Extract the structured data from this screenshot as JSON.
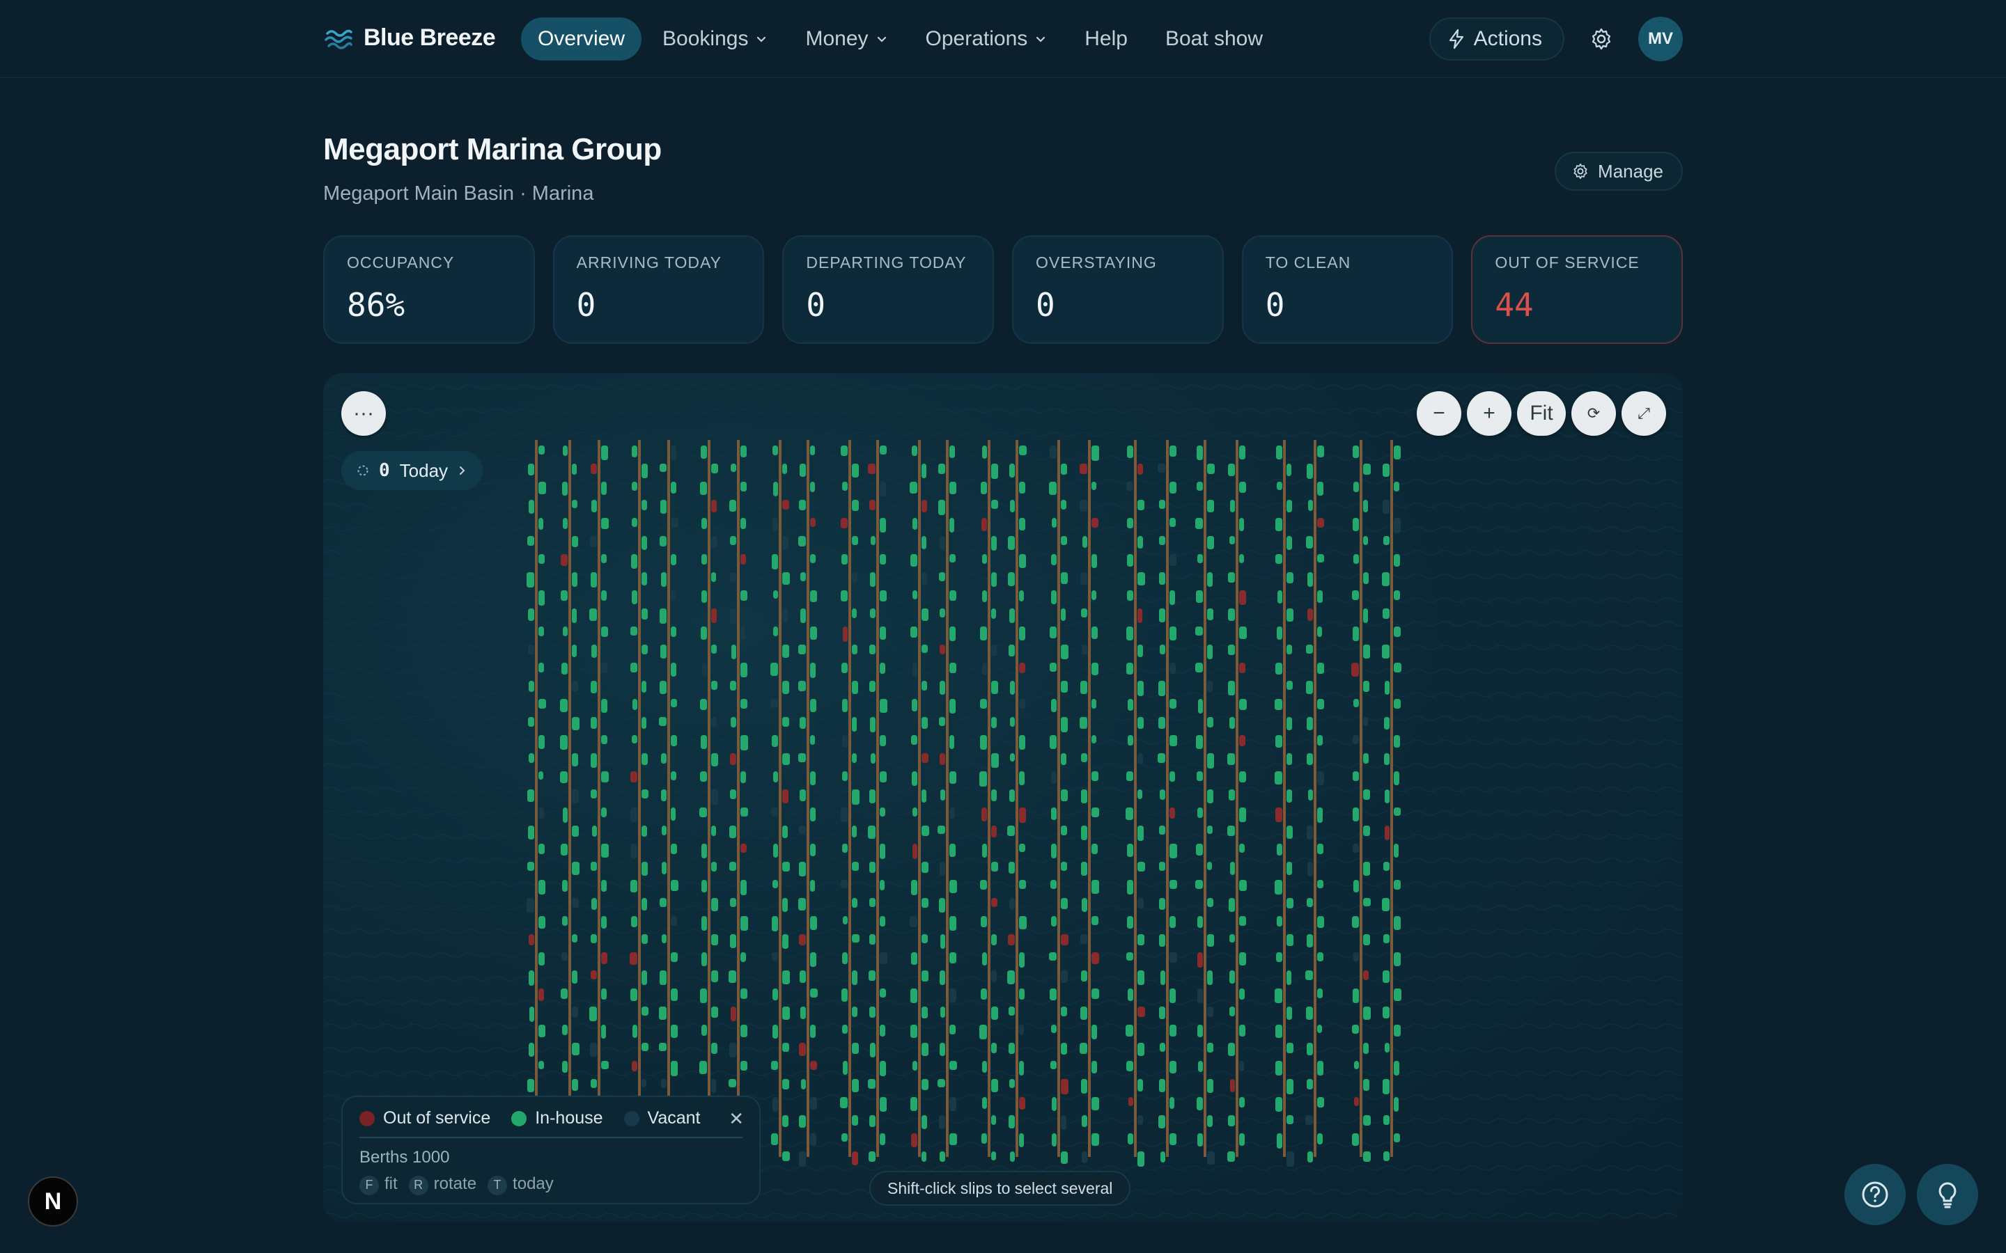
{
  "app": {
    "name": "Blue Breeze",
    "logo_icon": "waves-logo-icon"
  },
  "nav": {
    "items": [
      {
        "label": "Overview",
        "active": true,
        "dropdown": false
      },
      {
        "label": "Bookings",
        "active": false,
        "dropdown": true
      },
      {
        "label": "Money",
        "active": false,
        "dropdown": true
      },
      {
        "label": "Operations",
        "active": false,
        "dropdown": true
      },
      {
        "label": "Help",
        "active": false,
        "dropdown": false
      },
      {
        "label": "Boat show",
        "active": false,
        "dropdown": false
      }
    ],
    "actions_label": "Actions",
    "avatar_initials": "MV"
  },
  "header": {
    "title": "Megaport Marina Group",
    "subtitle": "Megaport Main Basin · Marina",
    "manage_label": "Manage"
  },
  "kpis": [
    {
      "label": "OCCUPANCY",
      "value": "86%"
    },
    {
      "label": "ARRIVING TODAY",
      "value": "0"
    },
    {
      "label": "DEPARTING TODAY",
      "value": "0"
    },
    {
      "label": "OVERSTAYING",
      "value": "0"
    },
    {
      "label": "TO CLEAN",
      "value": "0"
    },
    {
      "label": "OUT OF SERVICE",
      "value": "44"
    }
  ],
  "map": {
    "more_label": "···",
    "zoom_out_label": "−",
    "zoom_in_label": "+",
    "fit_label": "Fit",
    "rotate_label": "⟳",
    "expand_label": "⤢",
    "today": {
      "count": "0",
      "label": "Today"
    },
    "legend": {
      "items": [
        {
          "label": "Out of service",
          "color": "#7a2326"
        },
        {
          "label": "In-house",
          "color": "#23a86c"
        },
        {
          "label": "Vacant",
          "color": "#18394a"
        }
      ],
      "berths_label": "Berths 1000",
      "shortcuts": [
        {
          "key": "F",
          "label": "fit"
        },
        {
          "key": "R",
          "label": "rotate"
        },
        {
          "key": "T",
          "label": "today"
        }
      ]
    },
    "hint": "Shift-click slips to select several",
    "colors": {
      "in_house": "#22a96b",
      "out_of_service": "#8a2a2b",
      "pier": "#7a5a3a",
      "vacant": "#183a48"
    }
  },
  "fabs": {
    "n_badge": "N",
    "help_icon": "question-circle-icon",
    "tips_icon": "lightbulb-icon"
  }
}
